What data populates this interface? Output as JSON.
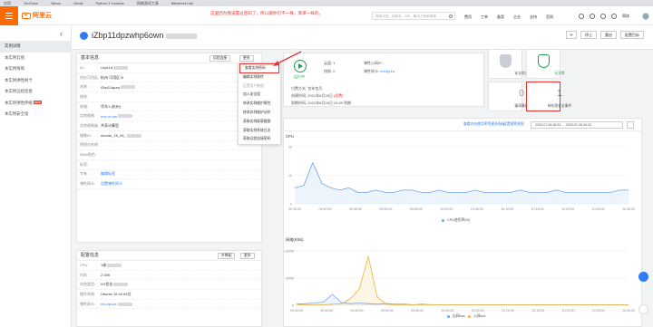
{
  "bookmarks": [
    "应用",
    "YouTube",
    "Yahoo",
    "Gmail",
    "Python 3 Youtube",
    "网络测试工具",
    "Bittorrent Lab"
  ],
  "topbar": {
    "logo_text": "阿里云",
    "search_placeholder": "搜索文档、控制台、API、解决方案和资源",
    "nav": [
      "费用",
      "工单",
      "备案",
      "企业",
      "支持",
      "官网"
    ],
    "lang": "简体"
  },
  "sidebar": {
    "back_glyph": "‹",
    "items": [
      "实例详情",
      "本实例云盘",
      "本实例快照",
      "本实例弹性网卡",
      "本实例远程连接",
      "本实例弹性伸缩",
      "本实例安全组"
    ],
    "new_badge": "NEW"
  },
  "header": {
    "instance_id": "iZbp11dpzwhp6own",
    "annotation": "这里因为我设置过密码了，所以跟你们不一样，简单一样的。",
    "buttons": {
      "stop": "停止",
      "restart": "重启",
      "config": "配置目标"
    }
  },
  "basic": {
    "title": "基本信息",
    "remote_btn": "远程连接",
    "more_btn": "更多",
    "rows": [
      {
        "k": "ID:",
        "v": "i-bp11d"
      },
      {
        "k": "所在可用区:",
        "v": "杭州 可用区 B"
      },
      {
        "k": "名称:",
        "v": "iZbp11dpzw"
      },
      {
        "k": "描述:",
        "v": ""
      },
      {
        "k": "地域:",
        "v": "华东1 (杭州)"
      },
      {
        "k": "实例规格:",
        "v": "ecs.n4.sm"
      },
      {
        "k": "实例规格族:",
        "v": "共享计算型"
      },
      {
        "k": "镜像ID:",
        "v": "ubuntu_16_04_"
      },
      {
        "k": "密钥对名称:",
        "v": ""
      },
      {
        "k": "RAM角色:",
        "v": ""
      },
      {
        "k": "标签:",
        "v": ""
      },
      {
        "k": "专有:",
        "v": "编辑标签"
      },
      {
        "k": "弹性网卡:",
        "v": "设置弹性网卡"
      }
    ]
  },
  "config": {
    "title": "配置信息",
    "upgrade_btn": "升降配",
    "more_btn": "更多",
    "rows": [
      {
        "k": "CPU:",
        "v": "1核"
      },
      {
        "k": "内存:",
        "v": "2 GiB"
      },
      {
        "k": "实例类型:",
        "v": "I/O优化"
      },
      {
        "k": "操作系统:",
        "v": "Ubuntu 16.04 64位"
      },
      {
        "k": "弹性网卡:",
        "v": "eni-bp1ax"
      }
    ]
  },
  "more_menu": [
    "查看实例密码",
    "编辑实例属性",
    "设置用户数据",
    "加入安全组",
    "修改实例维护属性",
    "修改实例维护动作",
    "获取实例屏幕截图",
    "获取实例系统日志",
    "获取远程连接密码"
  ],
  "status": {
    "label": "运行中",
    "items": [
      {
        "label": "云盘:",
        "value": "1"
      },
      {
        "label": "快照:",
        "value": "0"
      },
      {
        "label": "弹性公网IP:",
        "value": "-"
      },
      {
        "label": "弹性网卡:",
        "value": "eni-bp1a"
      }
    ],
    "pay_label": "付费方式:",
    "pay_value": "包年包月",
    "create_label": "创建时间:",
    "create_value": "2021年6月26日",
    "expire_label": "到期时间:",
    "expire_value": "2021年6月26日 23:59 到期",
    "renew": "(续费)"
  },
  "cards": [
    {
      "label": "安全状态",
      "kind": "shield-grey"
    },
    {
      "label": "无异常",
      "kind": "shield-green"
    },
    {
      "label": "漏洞事件",
      "value": "0"
    },
    {
      "label": "待处理安全事件",
      "value": "1"
    }
  ],
  "monitor": {
    "link1": "查看内存使用率等更多指标",
    "link2": "设置报警规则",
    "date_from": "2020-07-06 08:33",
    "date_to": "2020-07-06 09:33",
    "date_sep": "-",
    "cpu_title": "CPU",
    "cpu_legend": "CPU使用率(%)",
    "net_title": "网络(Kb/s)",
    "net_legend_in": "出网bps",
    "net_legend_out": "入网bps"
  },
  "chart_data": [
    {
      "type": "line",
      "title": "CPU",
      "x": [
        "09:35:00",
        "09:40:00",
        "09:45:00",
        "09:50:00",
        "09:55:00",
        "10:00:00",
        "10:05:00",
        "10:10:00",
        "10:15:00",
        "10:20:00",
        "10:25:00",
        "10:30:00"
      ],
      "ylim": [
        0,
        25
      ],
      "yticks": [
        "25",
        "10",
        "0"
      ],
      "series": [
        {
          "name": "CPU使用率(%)",
          "color": "#6ea4ea",
          "values": [
            7,
            8,
            18,
            9,
            7,
            6,
            7,
            5,
            5,
            6,
            5,
            5,
            6,
            6,
            5,
            5,
            6,
            5,
            5,
            5,
            6,
            5,
            5,
            5,
            5,
            6,
            5,
            5,
            5,
            6,
            5,
            5,
            5,
            5,
            5,
            5,
            6,
            6
          ]
        }
      ]
    },
    {
      "type": "line",
      "title": "网络(Kb/s)",
      "x": [
        "09:35:00",
        "09:40:00",
        "09:45:00",
        "09:50:00",
        "09:55:00",
        "10:00:00",
        "10:05:00",
        "10:10:00",
        "10:15:00",
        "10:20:00",
        "10:25:00",
        "10:30:00"
      ],
      "ylim": [
        0,
        1000
      ],
      "yticks": [
        "1,000M",
        "500M",
        "0"
      ],
      "series": [
        {
          "name": "出网bps",
          "color": "#6ea4ea",
          "values": [
            20,
            30,
            40,
            60,
            200,
            50,
            30,
            40,
            30,
            20,
            30,
            20,
            20,
            10,
            20,
            10,
            10,
            10,
            10,
            10,
            10,
            10,
            10,
            10,
            10,
            10,
            10,
            10,
            10,
            10,
            10,
            10,
            10,
            10,
            10,
            10,
            10,
            10
          ]
        },
        {
          "name": "入网bps",
          "color": "#f2b13b",
          "values": [
            10,
            10,
            10,
            10,
            20,
            30,
            120,
            300,
            900,
            150,
            20,
            10,
            10,
            10,
            10,
            10,
            10,
            10,
            10,
            10,
            10,
            10,
            10,
            10,
            10,
            10,
            10,
            10,
            10,
            10,
            10,
            10,
            10,
            10,
            10,
            10,
            10,
            10
          ]
        }
      ]
    }
  ]
}
